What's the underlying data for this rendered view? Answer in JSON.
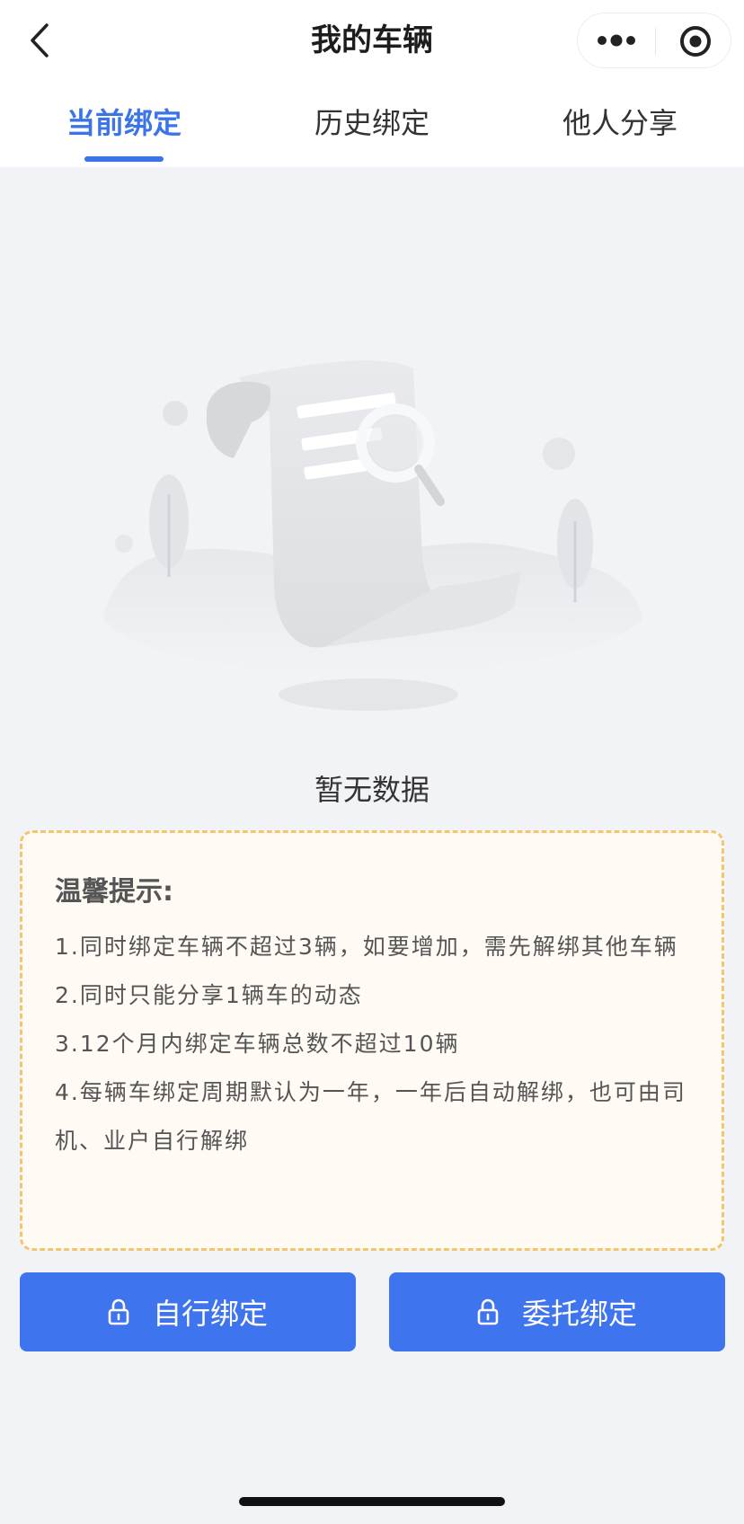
{
  "header": {
    "title": "我的车辆"
  },
  "tabs": [
    {
      "label": "当前绑定",
      "active": true
    },
    {
      "label": "历史绑定",
      "active": false
    },
    {
      "label": "他人分享",
      "active": false
    }
  ],
  "empty_state": {
    "text": "暂无数据"
  },
  "tips": {
    "title": "温馨提示:",
    "items": [
      "1.同时绑定车辆不超过3辆，如要增加，需先解绑其他车辆",
      "2.同时只能分享1辆车的动态",
      "3.12个月内绑定车辆总数不超过10辆",
      "4.每辆车绑定周期默认为一年，一年后自动解绑，也可由司机、业户自行解绑"
    ]
  },
  "buttons": {
    "self_bind": "自行绑定",
    "entrust_bind": "委托绑定"
  },
  "colors": {
    "accent": "#3b74e6",
    "button": "#3f74ef",
    "tips_border": "#f2c56f",
    "tips_bg": "#fffbf4",
    "page_bg": "#f1f3f6"
  },
  "icons": [
    "back-icon",
    "more-icon",
    "target-icon",
    "lock-icon"
  ]
}
